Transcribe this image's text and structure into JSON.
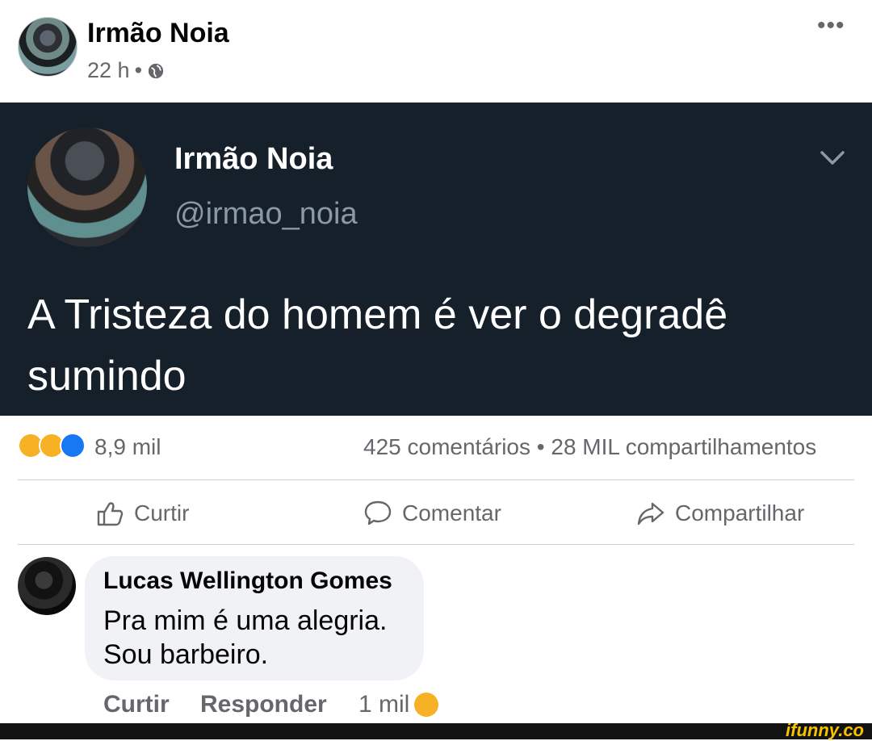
{
  "post": {
    "author": "Irmão Noia",
    "time": "22 h",
    "separator": "•",
    "more_label": "•••"
  },
  "tweet": {
    "name": "Irmão Noia",
    "handle": "@irmao_noia",
    "text": "A Tristeza do homem é ver o degradê sumindo"
  },
  "summary": {
    "reaction_count": "8,9 mil",
    "comments_shares": "425 comentários • 28 MIL compartilhamentos",
    "reaction_icons": [
      "sad-reaction-icon",
      "haha-reaction-icon",
      "like-reaction-icon"
    ]
  },
  "actions": {
    "like": "Curtir",
    "comment": "Comentar",
    "share": "Compartilhar"
  },
  "comment": {
    "author": "Lucas Wellington Gomes",
    "text": "Pra mim é uma alegria. Sou barbeiro.",
    "like_label": "Curtir",
    "reply_label": "Responder",
    "reaction_count": "1 mil"
  },
  "watermark": "ifunny.co",
  "colors": {
    "tweet_bg": "#15202b",
    "meta_gray": "#65676b",
    "like_blue": "#1877f2",
    "reaction_yellow": "#f7b125"
  }
}
